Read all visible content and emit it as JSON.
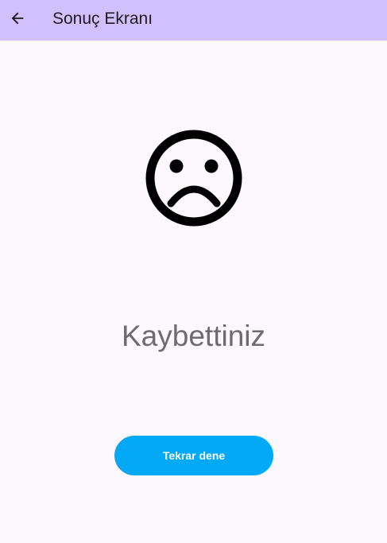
{
  "app_bar": {
    "title": "Sonuç Ekranı",
    "back_icon": "arrow-back-icon",
    "background_color": "#d1c0fb"
  },
  "main": {
    "face_icon": "sad-face-icon",
    "result_text": "Kaybettiniz",
    "retry_button_label": "Tekrar dene",
    "retry_button_color": "#03a9f4"
  }
}
